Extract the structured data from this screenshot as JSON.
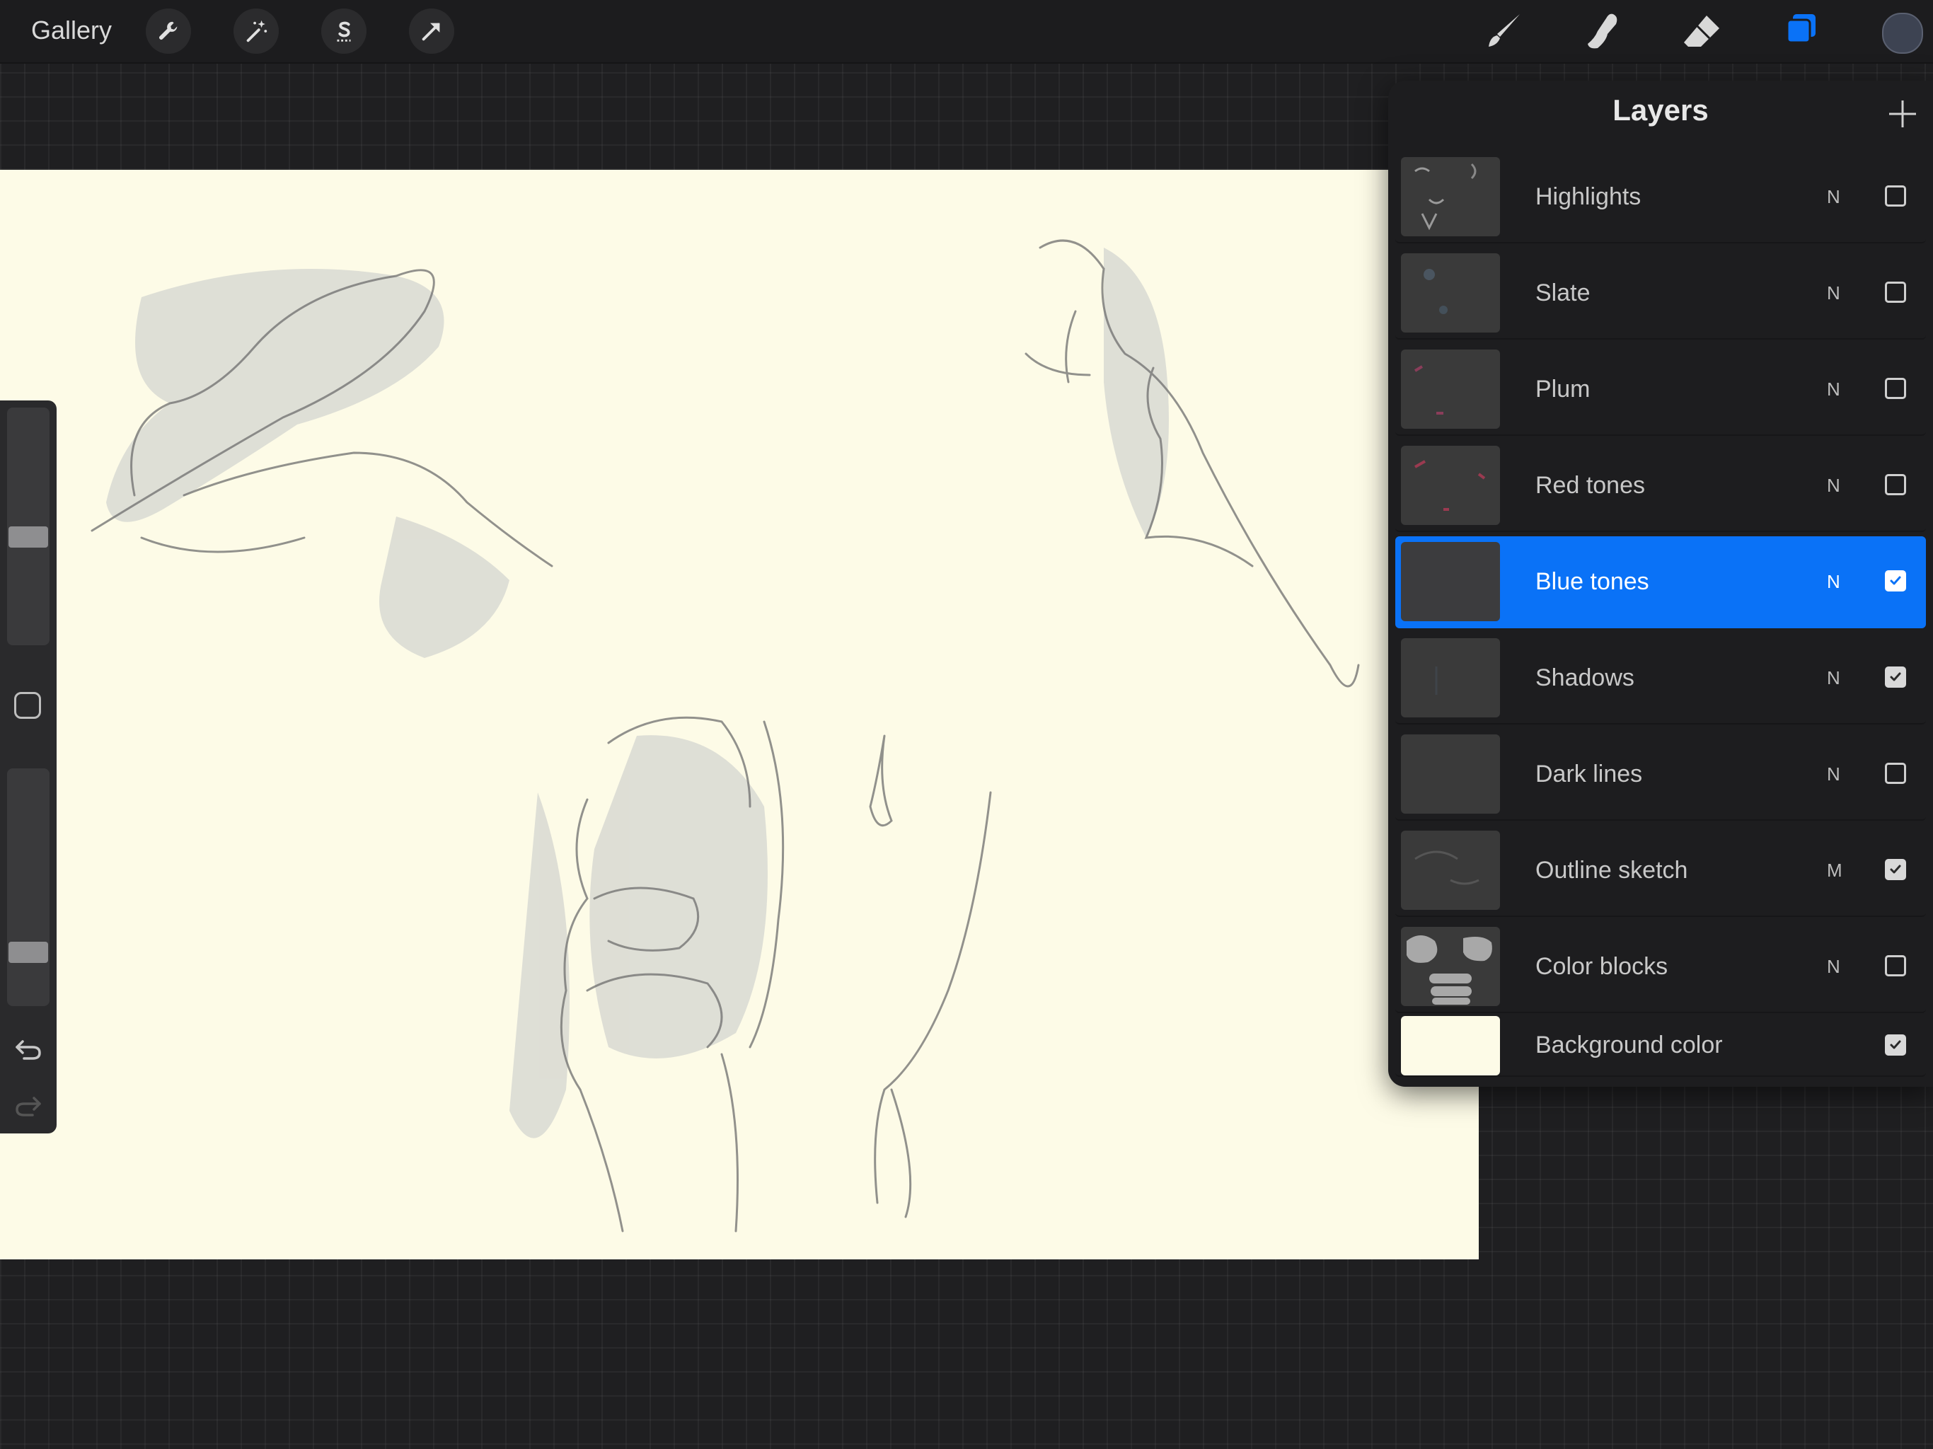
{
  "topbar": {
    "gallery_label": "Gallery",
    "left_tools": [
      "wrench-icon",
      "magic-wand-icon",
      "selection-s-icon",
      "transform-arrow-icon"
    ],
    "right_tools": [
      "brush-icon",
      "smudge-icon",
      "eraser-icon",
      "layers-icon"
    ],
    "accent_color": "#0a72f7",
    "current_color": "#3d4352"
  },
  "sidebar": {
    "brush_size_level": 0.55,
    "opacity_level": 0.8,
    "icons": [
      "modifier-square-icon",
      "undo-icon",
      "redo-icon"
    ]
  },
  "layers_panel": {
    "title": "Layers",
    "add_icon": "plus-icon",
    "layers": [
      {
        "name": "Highlights",
        "blend": "N",
        "visible": false,
        "active": false
      },
      {
        "name": "Slate",
        "blend": "N",
        "visible": false,
        "active": false
      },
      {
        "name": "Plum",
        "blend": "N",
        "visible": false,
        "active": false
      },
      {
        "name": "Red tones",
        "blend": "N",
        "visible": false,
        "active": false
      },
      {
        "name": "Blue tones",
        "blend": "N",
        "visible": true,
        "active": true
      },
      {
        "name": "Shadows",
        "blend": "N",
        "visible": true,
        "active": false
      },
      {
        "name": "Dark lines",
        "blend": "N",
        "visible": false,
        "active": false
      },
      {
        "name": "Outline sketch",
        "blend": "M",
        "visible": true,
        "active": false
      },
      {
        "name": "Color blocks",
        "blend": "N",
        "visible": false,
        "active": false
      },
      {
        "name": "Background color",
        "blend": "",
        "visible": true,
        "active": false
      }
    ]
  },
  "canvas": {
    "background_color": "#fdfbe7"
  }
}
